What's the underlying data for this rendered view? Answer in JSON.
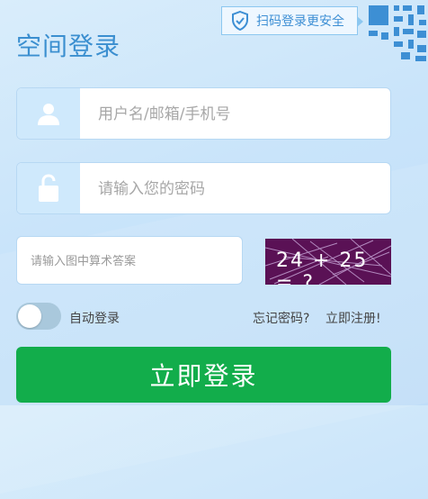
{
  "title": "空间登录",
  "qr_tip": {
    "label": "扫码登录更安全"
  },
  "username": {
    "placeholder": "用户名/邮箱/手机号",
    "value": ""
  },
  "password": {
    "placeholder": "请输入您的密码",
    "value": ""
  },
  "captcha": {
    "placeholder": "请输入图中算术答案",
    "value": "",
    "image_text": "24 + 25 = ?"
  },
  "auto_login": {
    "label": "自动登录",
    "enabled": false
  },
  "links": {
    "forgot": "忘记密码?",
    "register": "立即注册!"
  },
  "login_button": "立即登录",
  "colors": {
    "accent": "#3b8fd0",
    "button": "#12ad4b",
    "captcha_bg": "#5a1155",
    "icon_bg": "#cfe9fc",
    "toggle_off": "#a9c8dc"
  }
}
